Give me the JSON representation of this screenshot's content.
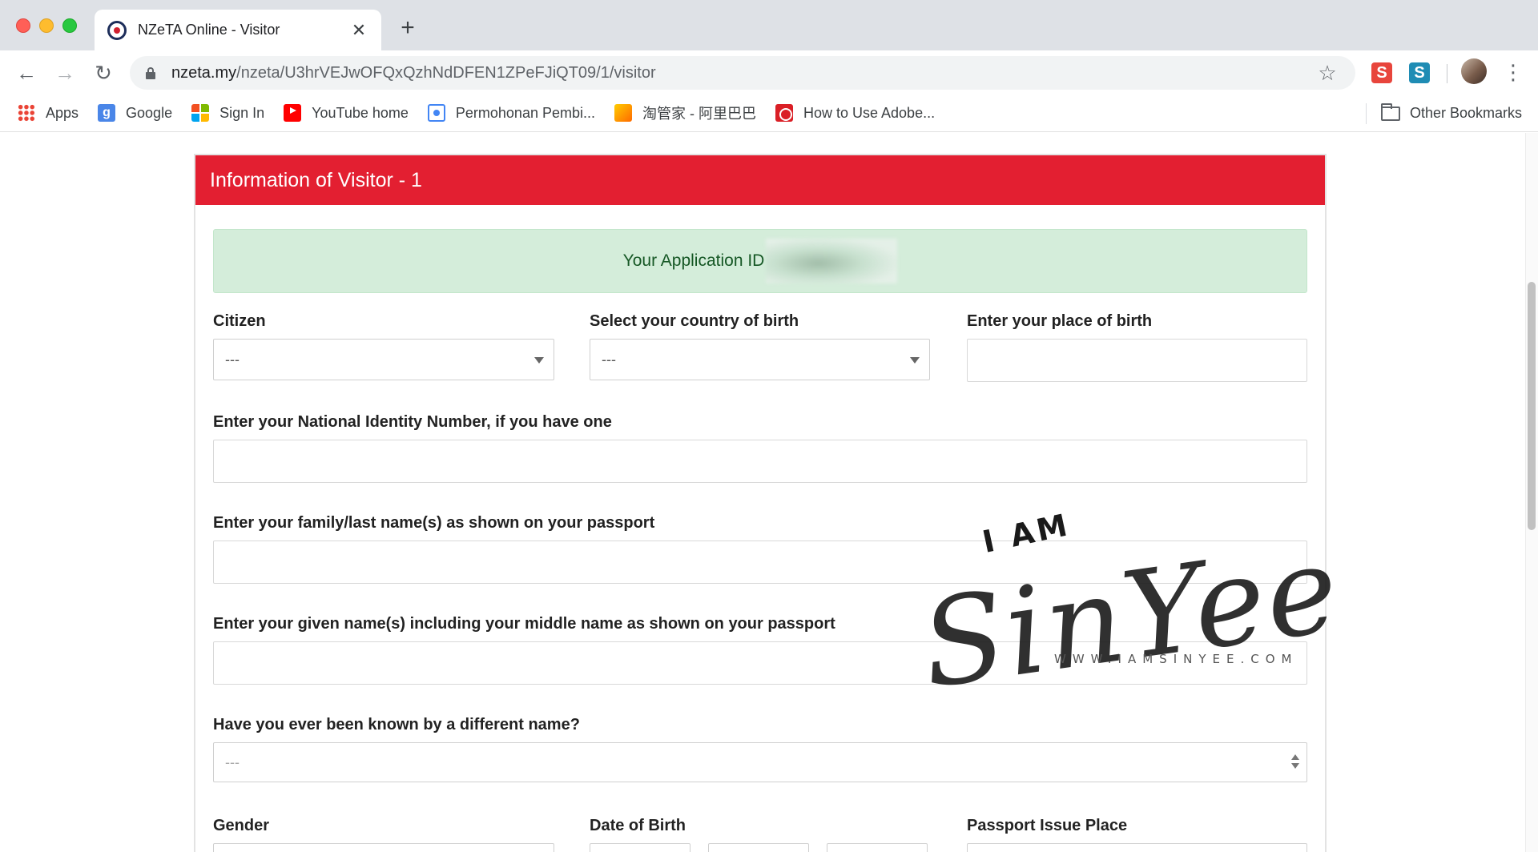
{
  "browser": {
    "tab_title": "NZeTA Online - Visitor",
    "tab_close": "✕",
    "new_tab": "+",
    "url_host": "nzeta.my",
    "url_path": "/nzeta/U3hrVEJwOFQxQzhNdDFEN1ZPeFJiQT09/1/visitor",
    "bookmarks": [
      {
        "label": "Apps",
        "icon": "apps-grid-icon"
      },
      {
        "label": "Google",
        "icon": "google-icon",
        "glyph": "g"
      },
      {
        "label": "Sign In",
        "icon": "microsoft-icon"
      },
      {
        "label": "YouTube home",
        "icon": "youtube-icon"
      },
      {
        "label": "Permohonan Pembi...",
        "icon": "circle-icon"
      },
      {
        "label": "淘管家 - 阿里巴巴",
        "icon": "taobao-icon"
      },
      {
        "label": "How to Use Adobe...",
        "icon": "adobe-icon"
      }
    ],
    "other_bookmarks": "Other Bookmarks",
    "extensions": [
      "S",
      "S"
    ]
  },
  "page": {
    "panel_title": "Information of Visitor - 1",
    "alert_text": "Your Application ID",
    "fields": {
      "citizen": {
        "label": "Citizen",
        "value": "---"
      },
      "country_of_birth": {
        "label": "Select your country of birth",
        "value": "---"
      },
      "place_of_birth": {
        "label": "Enter your place of birth",
        "value": ""
      },
      "national_id": {
        "label": "Enter your National Identity Number, if you have one",
        "value": ""
      },
      "family_name": {
        "label": "Enter your family/last name(s) as shown on your passport",
        "value": ""
      },
      "given_name": {
        "label": "Enter your given name(s) including your middle name as shown on your passport",
        "value": ""
      },
      "different_name": {
        "label": "Have you ever been known by a different name?",
        "value": "---"
      },
      "gender": {
        "label": "Gender"
      },
      "dob": {
        "label": "Date of Birth"
      },
      "passport_issue_place": {
        "label": "Passport Issue Place"
      }
    }
  },
  "watermark": {
    "top": "I AM",
    "script": "SinYee",
    "url": "WWW.IAMSINYEE.COM"
  },
  "colors": {
    "header_red": "#e31f31",
    "alert_bg": "#d4edda",
    "alert_text": "#155724"
  }
}
